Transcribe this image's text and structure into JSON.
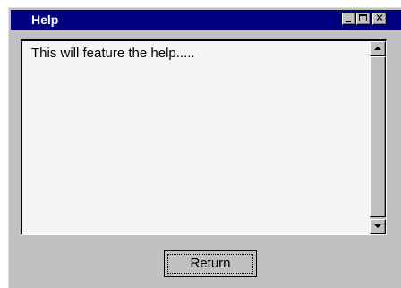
{
  "window": {
    "title": "Help",
    "title_bar_color": "#000080",
    "controls": {
      "minimize_icon": "minimize-icon",
      "maximize_icon": "maximize-icon",
      "close_icon": "close-icon",
      "close_glyph": "✕"
    }
  },
  "content": {
    "text": "This will feature the help....."
  },
  "scrollbar": {
    "up_icon": "scroll-up-icon",
    "down_icon": "scroll-down-icon"
  },
  "actions": {
    "return_label": "Return"
  }
}
